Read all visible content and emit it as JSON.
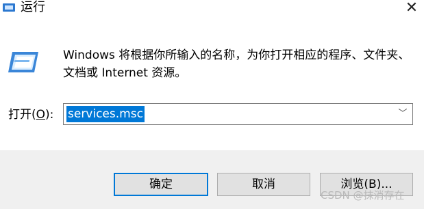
{
  "window": {
    "title": "运行",
    "close_glyph": "✕"
  },
  "dialog": {
    "description": "Windows 将根据你所输入的名称，为你打开相应的程序、文件夹、文档或 Internet 资源。",
    "open_label_prefix": "打开(",
    "open_label_hotkey": "O",
    "open_label_suffix": "):",
    "input_value": "services.msc",
    "dropdown_glyph": "﹀"
  },
  "buttons": {
    "ok": "确定",
    "cancel": "取消",
    "browse": "浏览(B)..."
  },
  "watermark": "CSDN @抹消存在",
  "colors": {
    "accent": "#0078d7",
    "footer_bg": "#f0f0f0",
    "button_bg": "#e1e1e1"
  }
}
